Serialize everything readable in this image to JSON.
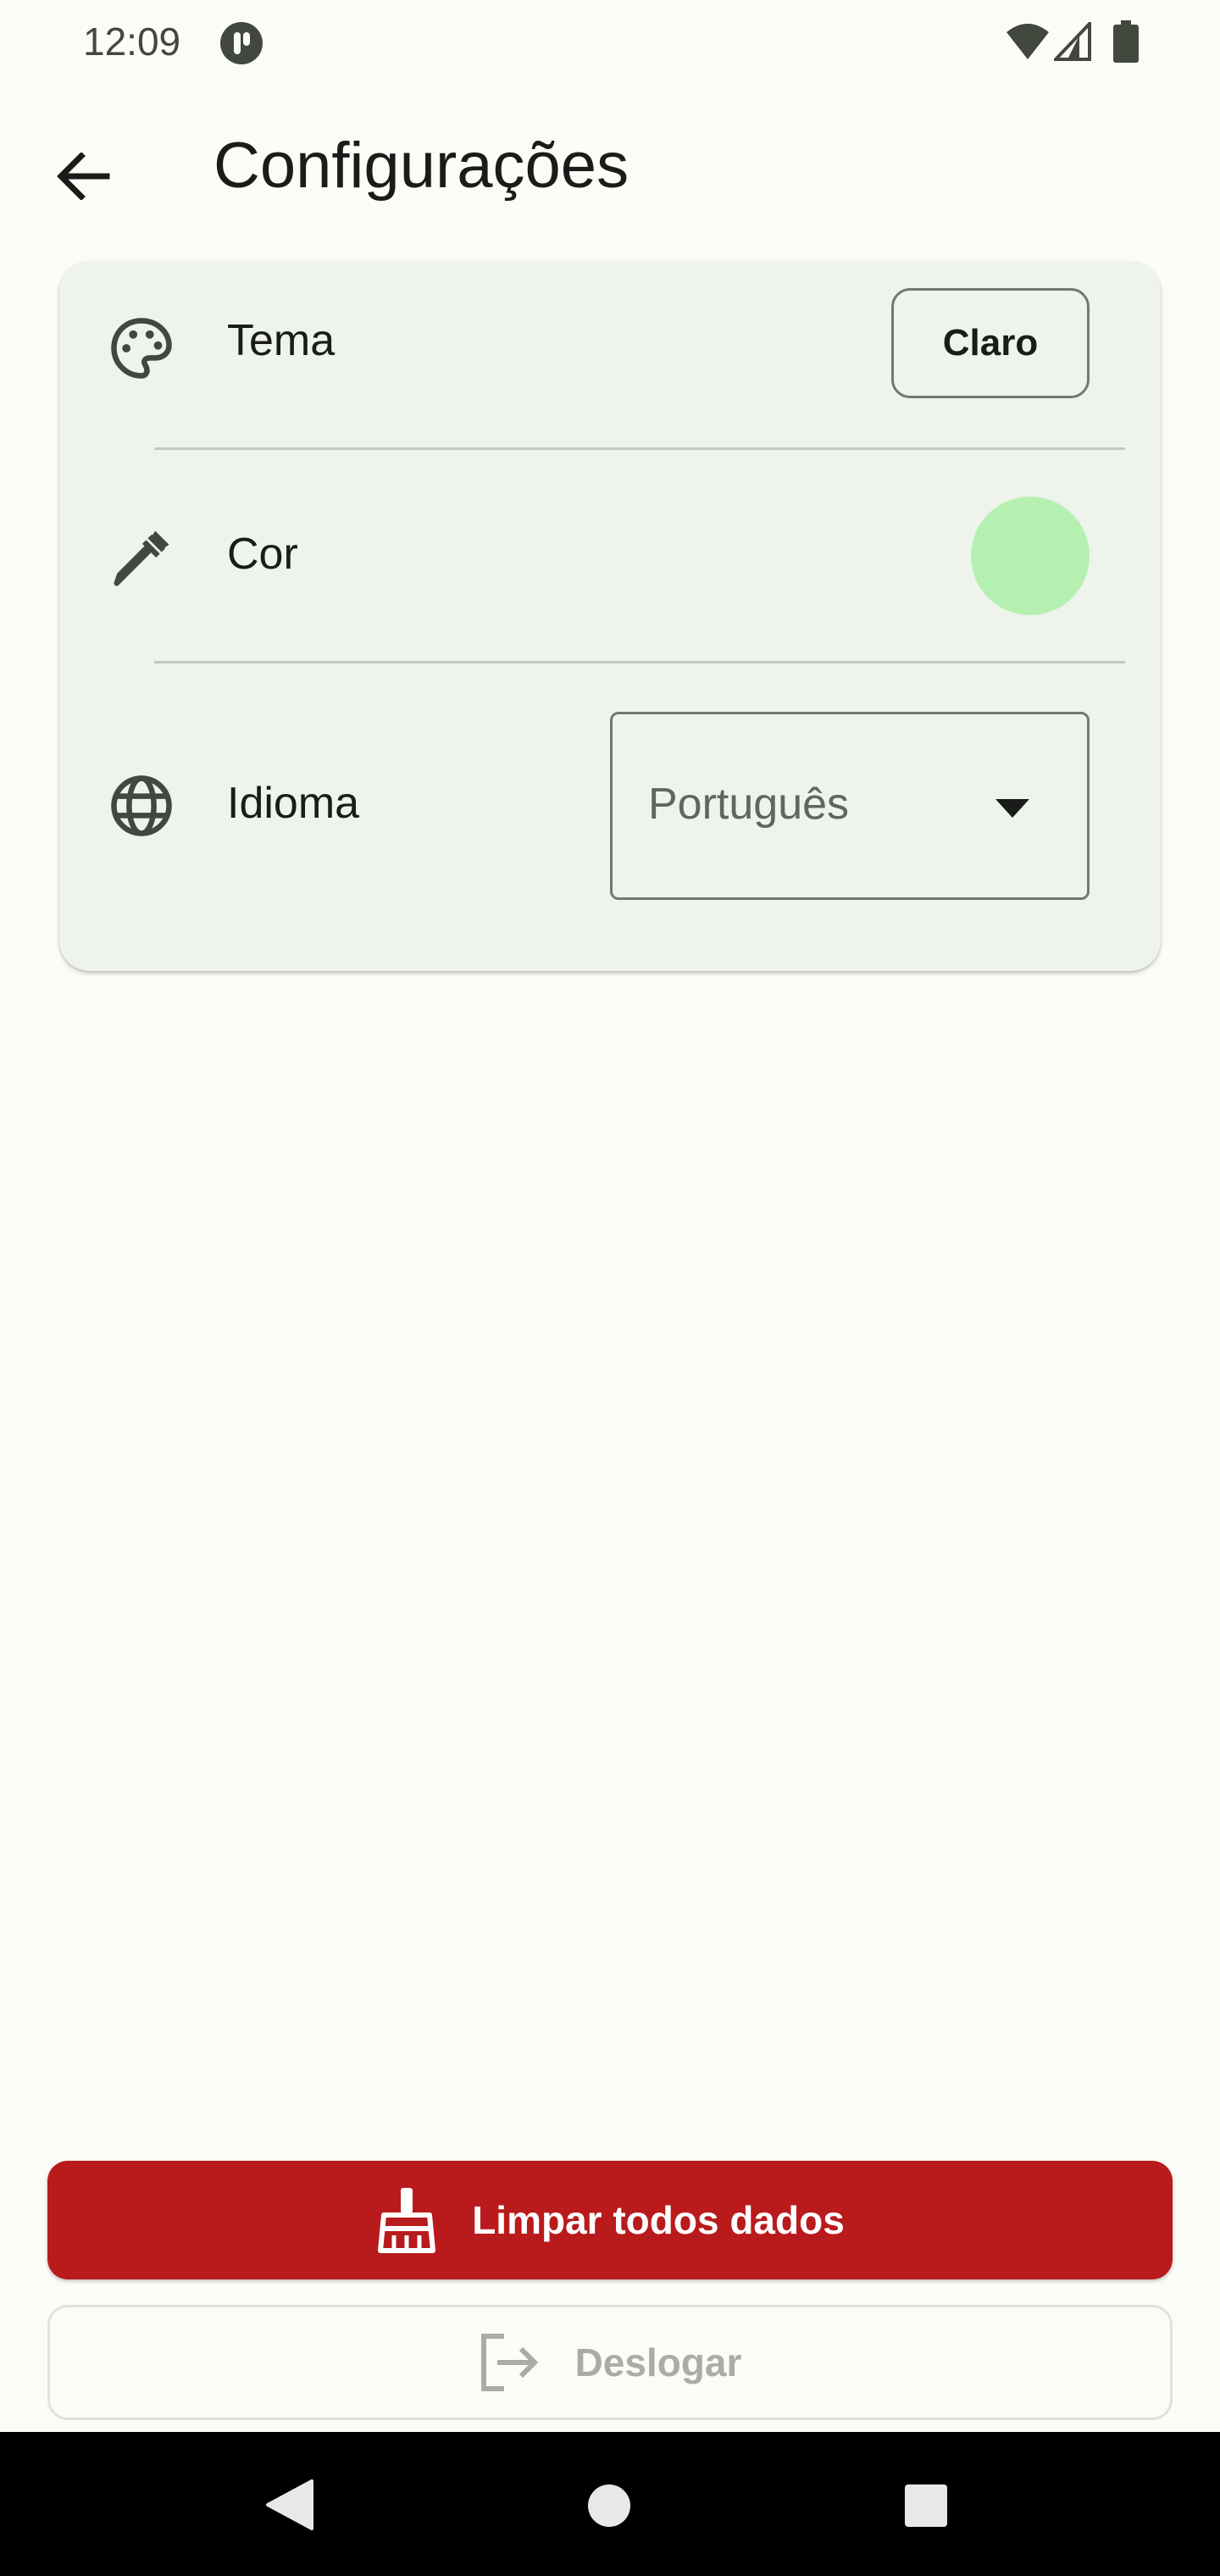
{
  "status_bar": {
    "time": "12:09",
    "icons": [
      "app-notification-icon",
      "wifi-icon",
      "cell-signal-icon",
      "battery-icon"
    ]
  },
  "app_bar": {
    "title": "Configurações",
    "back_icon": "arrow-back-icon"
  },
  "settings": {
    "theme": {
      "icon": "palette-icon",
      "label": "Tema",
      "value": "Claro"
    },
    "color": {
      "icon": "eyedropper-icon",
      "label": "Cor",
      "swatch_color": "#b5f0b1"
    },
    "language": {
      "icon": "globe-icon",
      "label": "Idioma",
      "selected": "Português"
    }
  },
  "actions": {
    "clear_data": {
      "icon": "broom-icon",
      "label": "Limpar todos dados",
      "color": "#b91a1c",
      "enabled": true
    },
    "logout": {
      "icon": "logout-icon",
      "label": "Deslogar",
      "enabled": false
    }
  },
  "nav_bar": {
    "icons": [
      "nav-back-icon",
      "nav-home-icon",
      "nav-recents-icon"
    ]
  },
  "colors": {
    "background": "#fbfcf7",
    "card": "#eef3eb",
    "outline": "#73796e",
    "danger": "#b91a1c"
  }
}
